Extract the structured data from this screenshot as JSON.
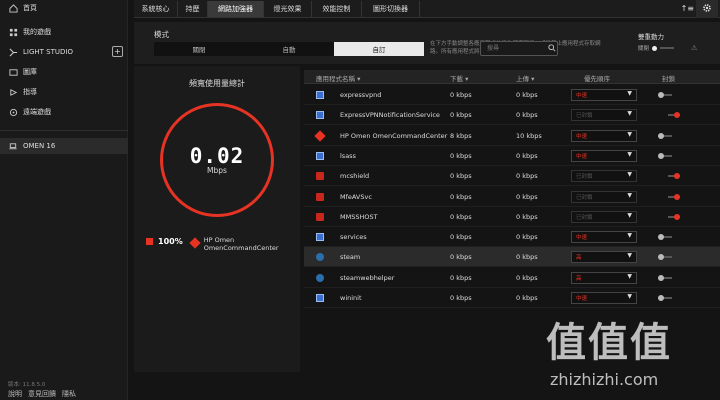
{
  "sidebar": {
    "items": [
      {
        "label": "首頁",
        "icon": "home-icon"
      },
      {
        "label": "我的遊戲",
        "icon": "gamepad-icon"
      },
      {
        "label": "LIGHT STUDIO",
        "icon": "lightstudio-icon"
      },
      {
        "label": "圖庫",
        "icon": "gallery-icon"
      },
      {
        "label": "指導",
        "icon": "coach-icon"
      },
      {
        "label": "遠端遊戲",
        "icon": "remote-play-icon"
      }
    ],
    "device": {
      "label": "OMEN 16",
      "icon": "laptop-icon"
    },
    "add_label": "+",
    "version": "版本: 11.8.5.0",
    "footer": {
      "explain": "說明",
      "feedback": "意見回饋",
      "privacy": "隱私"
    }
  },
  "tabs": [
    "系統核心",
    "持歷",
    "網路加強器",
    "燈光效果",
    "效能控制",
    "圖形切換器"
  ],
  "active_tab": 2,
  "mode": {
    "title": "模式",
    "options": [
      "關閉",
      "自動",
      "自訂"
    ],
    "active": 2,
    "description": "在下方手動調整各應用程式的優先順序層級，或是禁止應用程式存取網路。所有應用程式將會預設為「中」。",
    "search_placeholder": "搜尋",
    "dual_force": {
      "label": "雙重動力",
      "off_label": "關閉"
    }
  },
  "stats": {
    "title": "頻寬使用量總計",
    "speed_value": "0.02",
    "speed_unit": "Mbps",
    "top_percent": "100%",
    "top_app": "HP Omen OmenCommandCenter"
  },
  "table": {
    "headers": {
      "name": "應用程式名稱",
      "download": "下載",
      "upload": "上傳",
      "priority": "優先順序",
      "block": "封鎖"
    },
    "rows": [
      {
        "name": "expressvpnd",
        "download": "0 kbps",
        "upload": "0 kbps",
        "priority": "中速",
        "priority_enabled": true,
        "blocked": false,
        "icon": "win-app-icon"
      },
      {
        "name": "ExpressVPNNotificationService",
        "download": "0 kbps",
        "upload": "0 kbps",
        "priority": "已封鎖",
        "priority_enabled": false,
        "blocked": true,
        "icon": "win-app-icon"
      },
      {
        "name": "HP Omen OmenCommandCenter",
        "download": "8 kbps",
        "upload": "10 kbps",
        "priority": "中速",
        "priority_enabled": true,
        "blocked": false,
        "icon": "omen-icon"
      },
      {
        "name": "lsass",
        "download": "0 kbps",
        "upload": "0 kbps",
        "priority": "中速",
        "priority_enabled": true,
        "blocked": false,
        "icon": "win-app-icon"
      },
      {
        "name": "mcshield",
        "download": "0 kbps",
        "upload": "0 kbps",
        "priority": "已封鎖",
        "priority_enabled": false,
        "blocked": true,
        "icon": "mcafee-icon"
      },
      {
        "name": "MfeAVSvc",
        "download": "0 kbps",
        "upload": "0 kbps",
        "priority": "已封鎖",
        "priority_enabled": false,
        "blocked": true,
        "icon": "mcafee-icon"
      },
      {
        "name": "MMSSHOST",
        "download": "0 kbps",
        "upload": "0 kbps",
        "priority": "已封鎖",
        "priority_enabled": false,
        "blocked": true,
        "icon": "mcafee-icon"
      },
      {
        "name": "services",
        "download": "0 kbps",
        "upload": "0 kbps",
        "priority": "中速",
        "priority_enabled": true,
        "blocked": false,
        "icon": "win-app-icon"
      },
      {
        "name": "steam",
        "download": "0 kbps",
        "upload": "0 kbps",
        "priority": "高",
        "priority_enabled": true,
        "blocked": false,
        "icon": "steam-icon"
      },
      {
        "name": "steamwebhelper",
        "download": "0 kbps",
        "upload": "0 kbps",
        "priority": "高",
        "priority_enabled": true,
        "blocked": false,
        "icon": "steam-icon"
      },
      {
        "name": "wininit",
        "download": "0 kbps",
        "upload": "0 kbps",
        "priority": "中速",
        "priority_enabled": true,
        "blocked": false,
        "icon": "win-app-icon"
      }
    ],
    "selected_row": 8
  },
  "watermark": {
    "big": "值值值",
    "url": "zhizhizhi.com"
  },
  "colors": {
    "accent": "#e63323",
    "bg": "#141414",
    "panel": "#1b1b1b"
  }
}
